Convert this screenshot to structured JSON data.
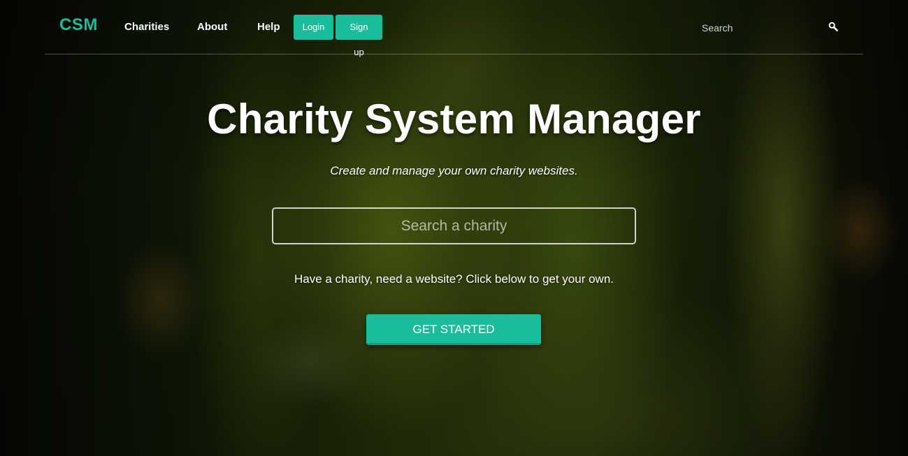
{
  "nav": {
    "brand": "CSM",
    "links": [
      "Charities",
      "About",
      "Help"
    ],
    "login_label": "Login",
    "signup_label": "Sign up",
    "search_placeholder": "Search",
    "search_icon": "search-icon"
  },
  "hero": {
    "title": "Charity System Manager",
    "subtitle": "Create and manage your own charity websites.",
    "search_placeholder": "Search a charity",
    "prompt": "Have a charity, need a website? Click below to get your own.",
    "cta_label": "GET STARTED"
  },
  "colors": {
    "accent": "#1abc9c",
    "accent_dark": "#16a085",
    "text": "#ffffff"
  }
}
